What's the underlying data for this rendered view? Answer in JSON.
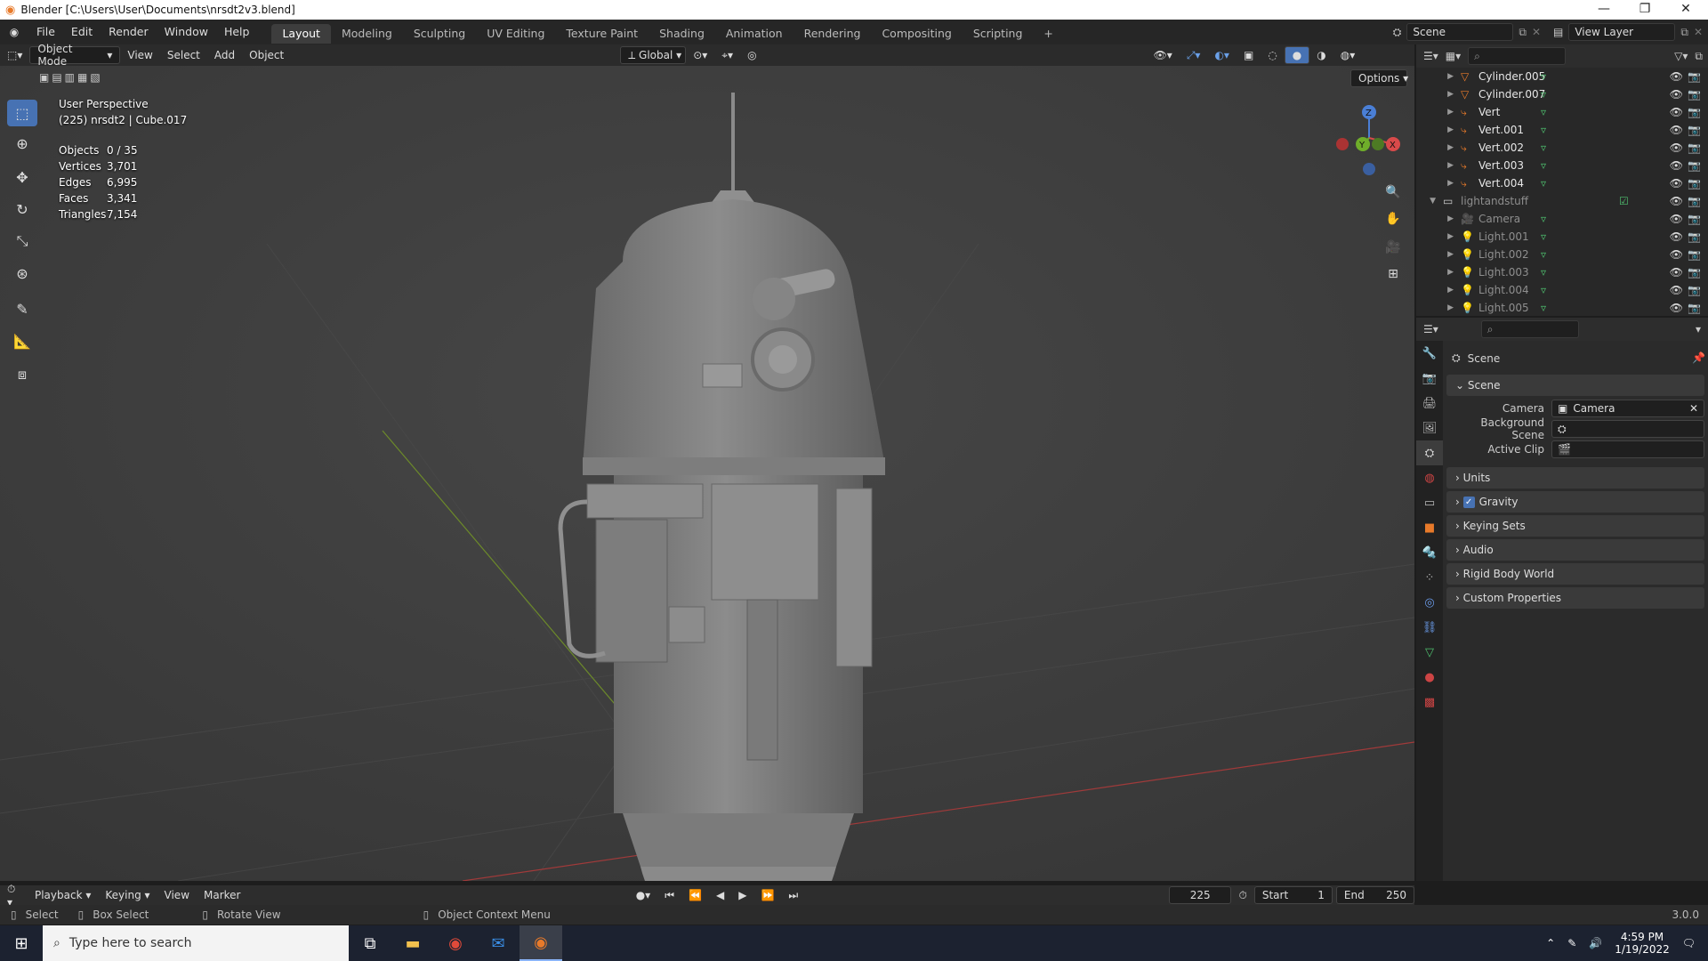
{
  "window": {
    "title": "Blender [C:\\Users\\User\\Documents\\nrsdt2v3.blend]"
  },
  "menu": [
    "File",
    "Edit",
    "Render",
    "Window",
    "Help"
  ],
  "workspaces": [
    "Layout",
    "Modeling",
    "Sculpting",
    "UV Editing",
    "Texture Paint",
    "Shading",
    "Animation",
    "Rendering",
    "Compositing",
    "Scripting"
  ],
  "active_workspace": "Layout",
  "scene_field": "Scene",
  "view_layer_field": "View Layer",
  "viewport_header": {
    "mode": "Object Mode",
    "menus": [
      "View",
      "Select",
      "Add",
      "Object"
    ],
    "orientation": "Global",
    "options": "Options"
  },
  "overlay": {
    "perspective": "User Perspective",
    "object_info": "(225) nrsdt2 | Cube.017",
    "stats": [
      {
        "label": "Objects",
        "value": "0 / 35"
      },
      {
        "label": "Vertices",
        "value": "3,701"
      },
      {
        "label": "Edges",
        "value": "6,995"
      },
      {
        "label": "Faces",
        "value": "3,341"
      },
      {
        "label": "Triangles",
        "value": "7,154"
      }
    ]
  },
  "gizmo": {
    "z": "Z",
    "y": "Y",
    "x": "X"
  },
  "outliner": {
    "rows": [
      {
        "name": "Cylinder.005",
        "type": "mesh"
      },
      {
        "name": "Cylinder.007",
        "type": "mesh"
      },
      {
        "name": "Vert",
        "type": "curve"
      },
      {
        "name": "Vert.001",
        "type": "curve"
      },
      {
        "name": "Vert.002",
        "type": "curve"
      },
      {
        "name": "Vert.003",
        "type": "curve"
      },
      {
        "name": "Vert.004",
        "type": "curve"
      },
      {
        "name": "lightandstuff",
        "type": "collection"
      },
      {
        "name": "Camera",
        "type": "camera"
      },
      {
        "name": "Light.001",
        "type": "light"
      },
      {
        "name": "Light.002",
        "type": "light"
      },
      {
        "name": "Light.003",
        "type": "light"
      },
      {
        "name": "Light.004",
        "type": "light"
      },
      {
        "name": "Light.005",
        "type": "light"
      }
    ]
  },
  "properties": {
    "context": "Scene",
    "section": "Scene",
    "camera_label": "Camera",
    "camera_value": "Camera",
    "background_scene_label": "Background Scene",
    "active_clip_label": "Active Clip",
    "panels": [
      "Units",
      "Gravity",
      "Keying Sets",
      "Audio",
      "Rigid Body World",
      "Custom Properties"
    ]
  },
  "timeline": {
    "menus": [
      "Playback",
      "Keying",
      "View",
      "Marker"
    ],
    "current_frame": "225",
    "start_label": "Start",
    "start": "1",
    "end_label": "End",
    "end": "250"
  },
  "statusbar": {
    "select": "Select",
    "box_select": "Box Select",
    "rotate_view": "Rotate View",
    "context_menu": "Object Context Menu",
    "version": "3.0.0"
  },
  "taskbar": {
    "search_placeholder": "Type here to search",
    "time": "4:59 PM",
    "date": "1/19/2022"
  },
  "colors": {
    "accent": "#4772b3",
    "mesh_icon": "#4fc16f",
    "curve_icon": "#e87a2a"
  }
}
